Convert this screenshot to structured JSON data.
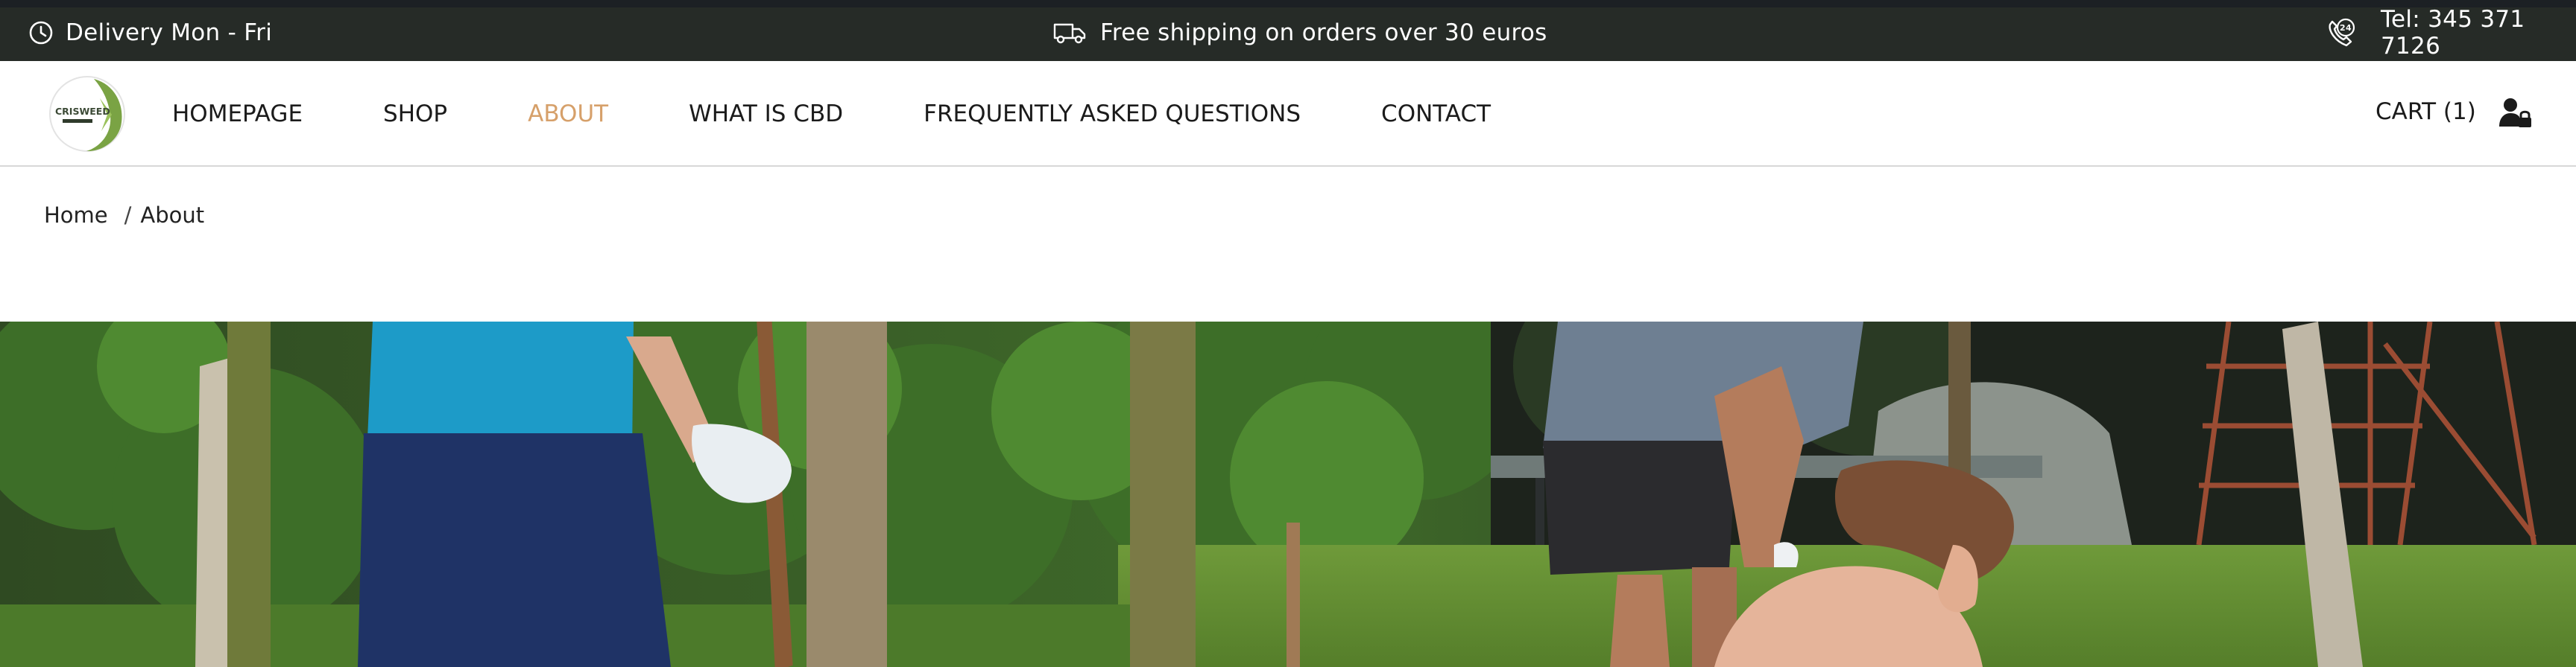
{
  "topbar": {
    "delivery_text": "Delivery Mon - Fri",
    "shipping_text": "Free shipping on orders over 30 euros",
    "phone_text": "Tel: 345 371 7126",
    "delivery_icon": "clock-icon",
    "shipping_icon": "delivery-truck-icon",
    "phone_icon": "24h-phone-icon"
  },
  "header": {
    "logo_text": "CRISWEED",
    "nav": [
      {
        "label": "HOMEPAGE"
      },
      {
        "label": "SHOP"
      },
      {
        "label": "ABOUT",
        "active": true
      },
      {
        "label": "WHAT IS CBD"
      },
      {
        "label": "FREQUENTLY ASKED QUESTIONS"
      },
      {
        "label": "CONTACT"
      }
    ],
    "cart_label": "CART (1)",
    "account_icon": "user-lock-icon"
  },
  "breadcrumb": {
    "home": "Home",
    "separator": "/",
    "current": "About"
  },
  "colors": {
    "topbar_bg": "#262b27",
    "accent_active": "#d6a06a",
    "text": "#1b1b1b"
  }
}
